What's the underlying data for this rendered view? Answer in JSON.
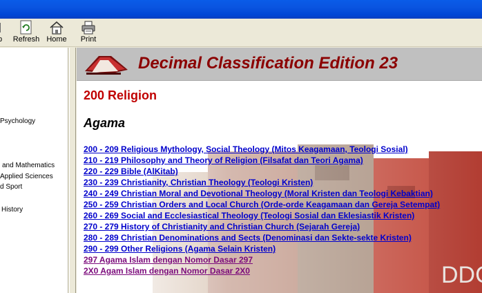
{
  "toolbar": {
    "partial_label": "p",
    "refresh_label": "Refresh",
    "home_label": "Home",
    "print_label": "Print"
  },
  "left_pane": {
    "items": [
      "Psychology",
      "and Mathematics",
      "Applied Sciences",
      "d Sport",
      "History"
    ]
  },
  "content": {
    "banner_title": "Decimal Classification Edition 23",
    "section_title": "200 Religion",
    "subtitle": "Agama",
    "links": [
      "200 - 209 Religious Mythology, Social Theology (Mitos Keagamaan, Teologi Sosial)",
      "210 - 219 Philosophy and Theory of Religion (Filsafat dan Teori Agama)",
      "220 - 229 Bible (AlKitab)",
      "230 - 239 Christianity, Christian Theology (Teologi Kristen)",
      "240 - 249 Christian Moral and Devotional Theology (Moral Kristen dan Teologi Kebaktian)",
      "250 - 259 Christian Orders and Local Church (Orde-orde Keagamaan dan Gereja Setempat)",
      "260 - 269 Social and Ecclesiastical Theology (Teologi Sosial dan Eklesiastik Kristen)",
      "270 - 279 History of Christianity and Christian Church (Sejarah Gereja)",
      "280 - 289 Christian Denominations and Sects (Denominasi dan Sekte-sekte Kristen)",
      "290 - 299 Other Religions (Agama Selain Kristen)",
      "297 Agama Islam dengan Nomor Dasar 297",
      "2X0 Agam Islam dengan Nomor Dasar 2X0"
    ],
    "background_text": "DDC"
  },
  "colors": {
    "title_bar": "#0a54e0",
    "banner_title": "#8b0000",
    "section_title": "#c00000",
    "link": "#0000cc",
    "visited_link": "#7b0a7b"
  }
}
